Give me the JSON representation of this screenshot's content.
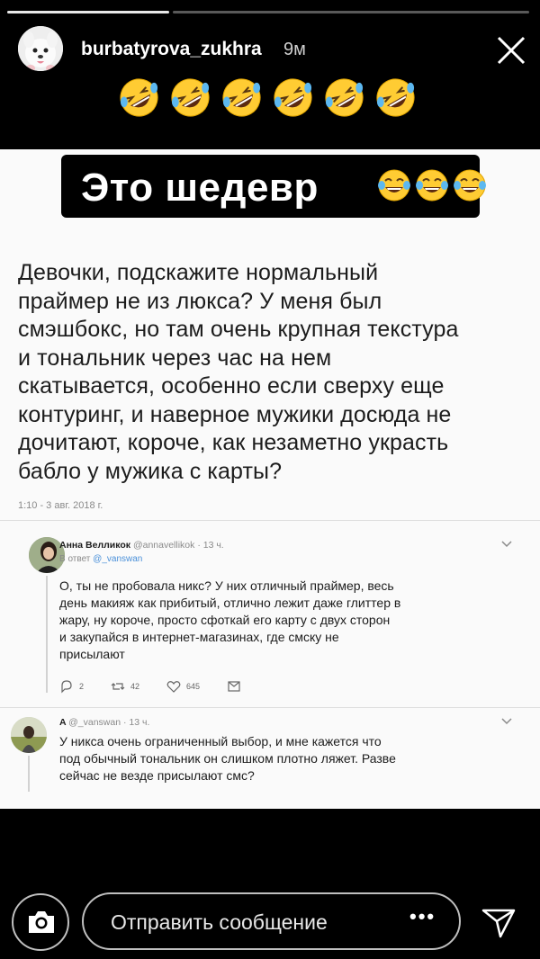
{
  "story": {
    "progress": 0.31,
    "username": "burbatyrova_zukhra",
    "time_ago": "9м",
    "reaction_emojis": [
      "rofl-emoji",
      "rofl-emoji",
      "rofl-emoji",
      "rofl-emoji",
      "rofl-emoji",
      "rofl-emoji"
    ]
  },
  "sticker": {
    "text": "Это шедевр",
    "emojis": [
      "joy-emoji",
      "joy-emoji",
      "joy-emoji"
    ]
  },
  "tweet": {
    "lines": [
      "Девочки, подскажите нормальный",
      "праймер не из люкса? У меня был",
      "смэшбокс,  но там очень крупная текстура",
      "и тональник через час на нем",
      "скатывается,  особенно если сверху еще",
      "контуринг, и наверное мужики досюда не",
      "дочитают, короче, как незаметно украсть",
      "бабло у мужика с карты?"
    ],
    "date": "1:10 - 3 авг. 2018 г."
  },
  "replies": [
    {
      "name": "Анна Велликок",
      "handle": "@annavellikok · 13 ч.",
      "reply_to_prefix": "В ответ",
      "reply_to_handle": "@_vanswan",
      "lines": [
        "О, ты не пробовала никс? У них отличный праймер, весь",
        "день макияж как прибитый, отлично лежит даже глиттер в",
        "жару, ну короче, просто сфоткай его карту с двух сторон",
        "и закупайся в интернет-магазинах, где смску не",
        "присылают"
      ],
      "actions": {
        "replies": "2",
        "retweets": "42",
        "likes": "645"
      }
    },
    {
      "name": "A",
      "handle": "@_vanswan · 13 ч.",
      "lines": [
        "У никса очень ограниченный выбор, и мне кажется что",
        "под обычный тональник он слишком плотно ляжет. Разве",
        "сейчас не везде присылают смс?"
      ]
    }
  ],
  "composer": {
    "placeholder": "Отправить сообщение",
    "more": "•••"
  },
  "icons": {
    "camera": "camera-icon",
    "send": "paper-plane-icon",
    "close": "close-icon"
  },
  "colors": {
    "background": "#000000",
    "document": "#fafafa",
    "emoji_yellow": "#ffcc33",
    "tear_blue": "#5cb8f0",
    "link_blue": "#4a90d9"
  }
}
